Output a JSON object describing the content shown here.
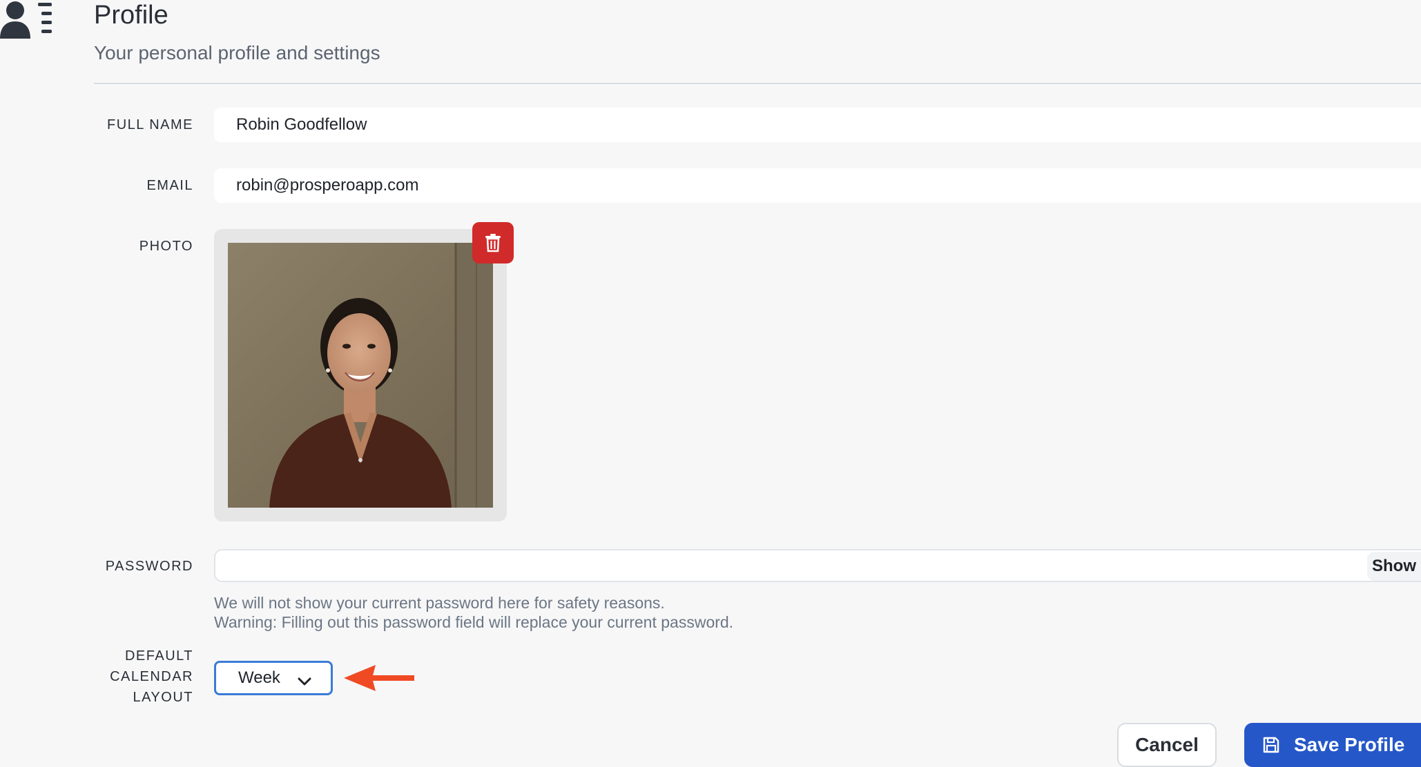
{
  "header": {
    "title": "Profile",
    "subtitle": "Your personal profile and settings",
    "icon": "user-list-icon"
  },
  "form": {
    "full_name": {
      "label": "FULL NAME",
      "value": "Robin Goodfellow"
    },
    "email": {
      "label": "EMAIL",
      "value": "robin@prosperoapp.com"
    },
    "photo": {
      "label": "PHOTO",
      "delete_icon": "trash-icon"
    },
    "password": {
      "label": "PASSWORD",
      "value": "",
      "show_label": "Show",
      "help_line_1": "We will not show your current password here for safety reasons.",
      "help_line_2": "Warning: Filling out this password field will replace your current password."
    },
    "calendar_layout": {
      "label_line_1": "DEFAULT",
      "label_line_2": "CALENDAR",
      "label_line_3": "LAYOUT",
      "selected": "Week"
    }
  },
  "actions": {
    "cancel_label": "Cancel",
    "save_label": "Save Profile",
    "save_icon": "floppy-disk-icon"
  },
  "colors": {
    "primary": "#2557c8",
    "danger": "#d12a2a",
    "focus": "#3a7bd5",
    "annotation_arrow": "#f04a24",
    "background": "#f7f7f8"
  }
}
